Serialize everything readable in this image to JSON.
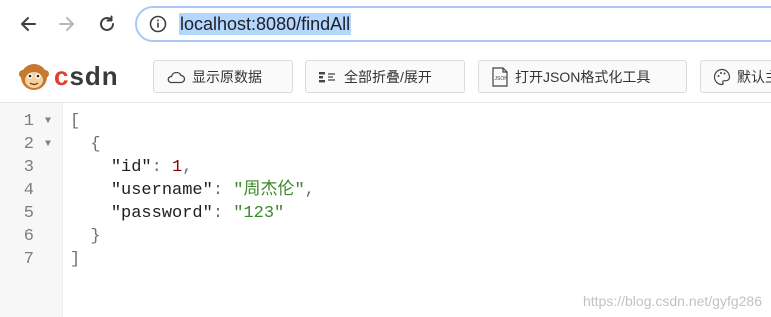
{
  "browser": {
    "url": "localhost:8080/findAll"
  },
  "extension": {
    "logo_text": "CSDN",
    "buttons": [
      {
        "label": "显示原数据",
        "icon": "cloud-icon"
      },
      {
        "label": "全部折叠/展开",
        "icon": "fold-icon"
      },
      {
        "label": "打开JSON格式化工具",
        "icon": "json-file-icon"
      },
      {
        "label": "默认主",
        "icon": "palette-icon"
      }
    ]
  },
  "json_view": {
    "line_numbers": [
      "1",
      "2",
      "3",
      "4",
      "5",
      "6",
      "7"
    ],
    "open_bracket": "[",
    "open_brace": "{",
    "close_brace": "}",
    "close_bracket": "]",
    "fields": [
      {
        "key": "\"id\"",
        "value": "1",
        "type": "number",
        "comma": ","
      },
      {
        "key": "\"username\"",
        "value": "\"周杰伦\"",
        "type": "string",
        "comma": ","
      },
      {
        "key": "\"password\"",
        "value": "\"123\"",
        "type": "string",
        "comma": ""
      }
    ]
  },
  "watermark": "https://blog.csdn.net/gyfg286",
  "colors": {
    "address_border": "#a8c7fa",
    "url_selection": "#b4d7ff",
    "number": "#880000",
    "string": "#3a8a2a"
  }
}
